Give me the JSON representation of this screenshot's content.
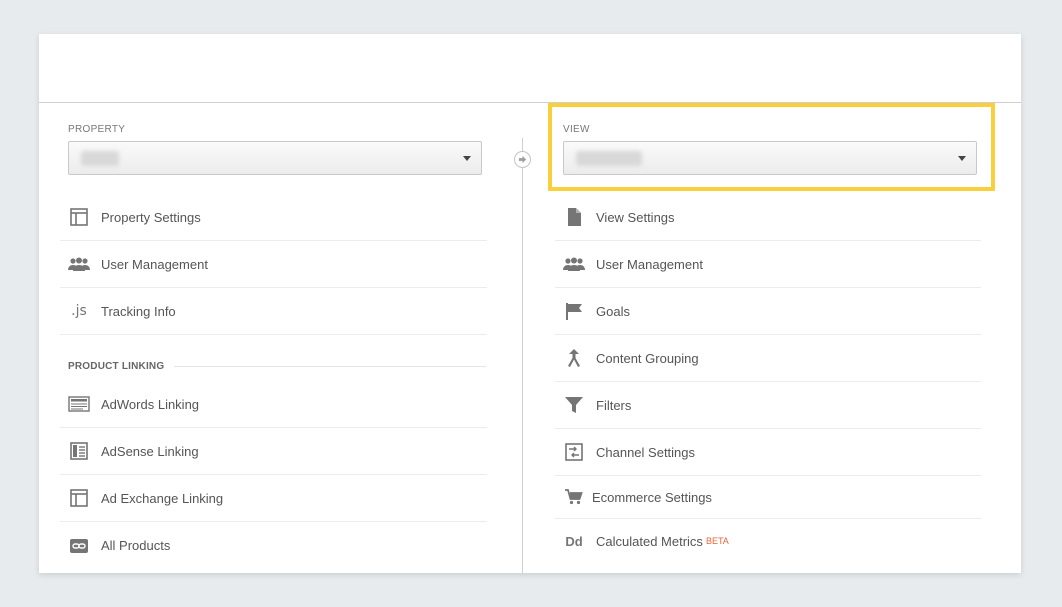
{
  "property": {
    "label": "PROPERTY",
    "items": [
      {
        "label": "Property Settings",
        "icon": "layout-icon"
      },
      {
        "label": "User Management",
        "icon": "users-icon"
      },
      {
        "label": "Tracking Info",
        "icon": "js-icon"
      }
    ],
    "product_linking": {
      "label": "PRODUCT LINKING",
      "items": [
        {
          "label": "AdWords Linking",
          "icon": "adwords-icon"
        },
        {
          "label": "AdSense Linking",
          "icon": "adsense-icon"
        },
        {
          "label": "Ad Exchange Linking",
          "icon": "ad-exchange-icon"
        },
        {
          "label": "All Products",
          "icon": "link-icon"
        }
      ]
    }
  },
  "view": {
    "label": "VIEW",
    "items": [
      {
        "label": "View Settings",
        "icon": "document-icon"
      },
      {
        "label": "User Management",
        "icon": "users-icon"
      },
      {
        "label": "Goals",
        "icon": "flag-icon"
      },
      {
        "label": "Content Grouping",
        "icon": "merge-icon"
      },
      {
        "label": "Filters",
        "icon": "filter-icon"
      },
      {
        "label": "Channel Settings",
        "icon": "channel-icon"
      },
      {
        "label": "Ecommerce Settings",
        "icon": "cart-icon"
      },
      {
        "label": "Calculated Metrics",
        "icon": "dd-icon",
        "badge": "BETA"
      }
    ]
  },
  "icons": {
    "js_glyph": ".js",
    "dd_glyph": "Dd"
  },
  "colors": {
    "highlight": "#f9cf3b",
    "beta": "#e8663d"
  }
}
